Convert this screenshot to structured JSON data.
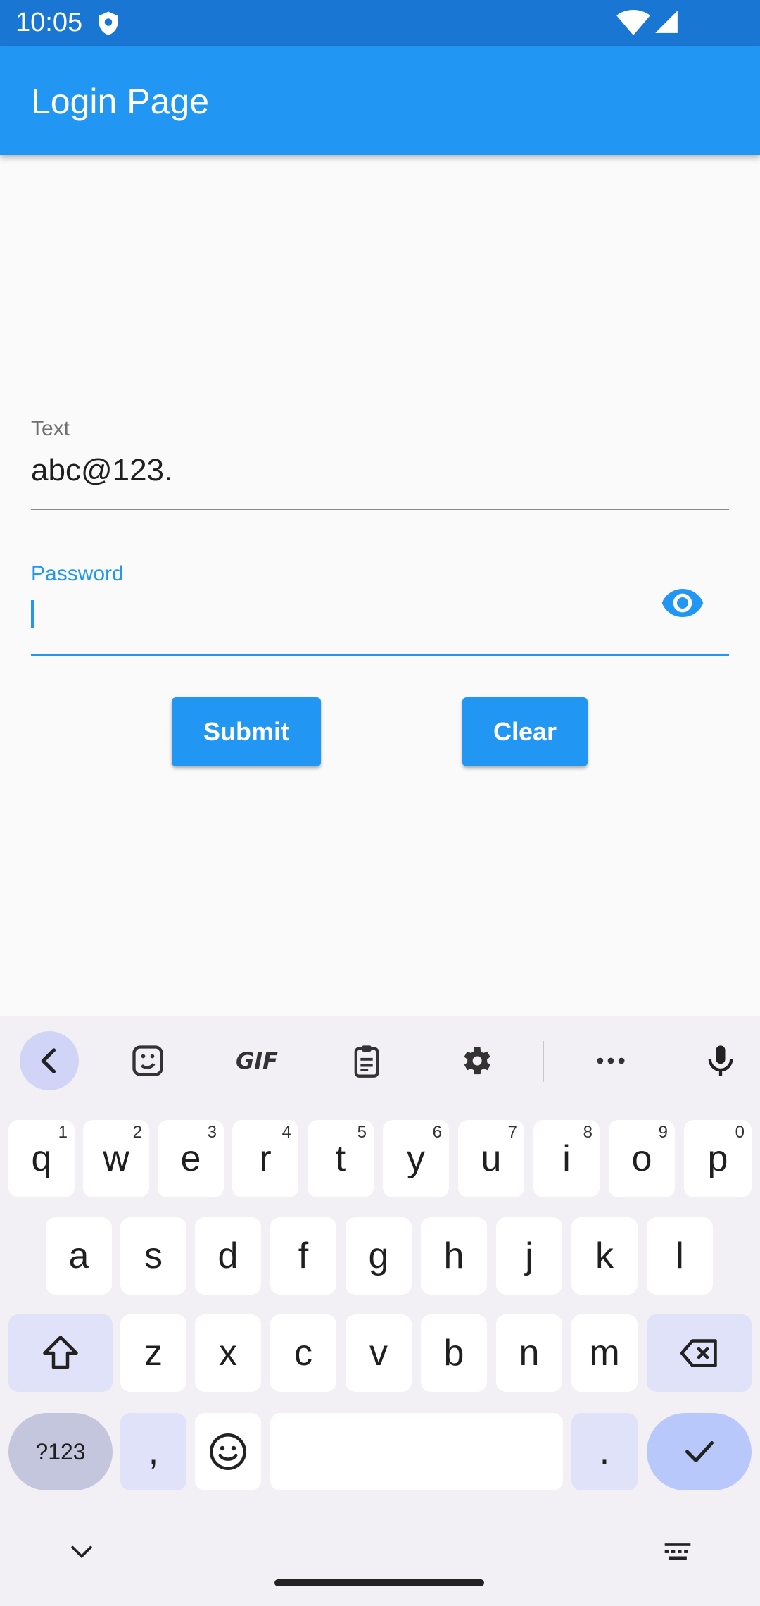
{
  "status_bar": {
    "time": "10:05"
  },
  "app_bar": {
    "title": "Login Page"
  },
  "form": {
    "text_field": {
      "label": "Text",
      "value": "abc@123."
    },
    "password_field": {
      "label": "Password",
      "value": ""
    },
    "submit_label": "Submit",
    "clear_label": "Clear"
  },
  "keyboard": {
    "toolbar_icons": [
      "back-chevron-icon",
      "sticker-icon",
      "gif-icon",
      "clipboard-icon",
      "settings-icon",
      "more-icon",
      "mic-icon"
    ],
    "gif_label": "GIF",
    "row1": [
      {
        "key": "q",
        "hint": "1"
      },
      {
        "key": "w",
        "hint": "2"
      },
      {
        "key": "e",
        "hint": "3"
      },
      {
        "key": "r",
        "hint": "4"
      },
      {
        "key": "t",
        "hint": "5"
      },
      {
        "key": "y",
        "hint": "6"
      },
      {
        "key": "u",
        "hint": "7"
      },
      {
        "key": "i",
        "hint": "8"
      },
      {
        "key": "o",
        "hint": "9"
      },
      {
        "key": "p",
        "hint": "0"
      }
    ],
    "row2": [
      "a",
      "s",
      "d",
      "f",
      "g",
      "h",
      "j",
      "k",
      "l"
    ],
    "row3": [
      "z",
      "x",
      "c",
      "v",
      "b",
      "n",
      "m"
    ],
    "symbols_label": "?123",
    "comma_label": ",",
    "period_label": "."
  },
  "colors": {
    "status_bar": "#1976d2",
    "app_bar": "#2196f3",
    "accent": "#2196f3",
    "keyboard_bg": "#f2eff5"
  }
}
